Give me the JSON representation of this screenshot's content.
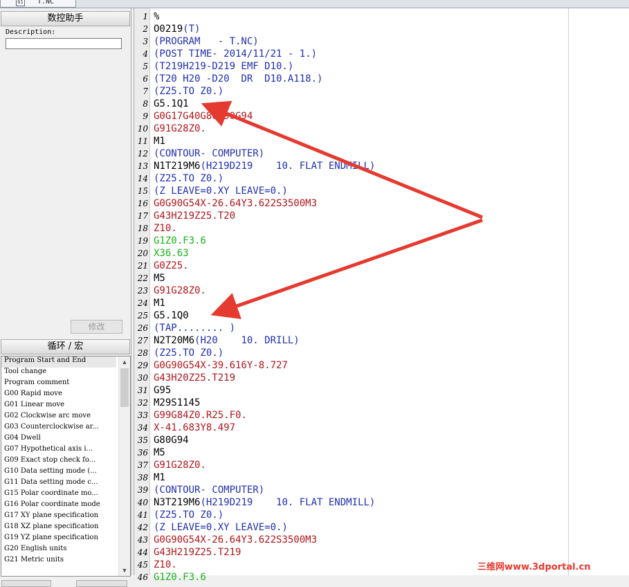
{
  "tab": {
    "icon": "file-icon",
    "icon_label": "G1",
    "label": "T.NC"
  },
  "left_panel": {
    "title": "数控助手",
    "description_label": "Description:",
    "description_value": "",
    "modify_button": "修改",
    "macros_title": "循环 / 宏",
    "macros": [
      "Program Start and End",
      "Tool change",
      "Program comment",
      "G00 Rapid move",
      "G01 Linear move",
      "G02 Clockwise arc move",
      "G03 Counterclockwise ar...",
      "G04 Dwell",
      "G07 Hypothetical axis i...",
      "G09 Exact stop check fo...",
      "G10 Data setting mode (...",
      "G11 Data setting mode c...",
      "G15 Polar coordinate mo...",
      "G16 Polar coordinate mode",
      "G17 XY plane specification",
      "G18 XZ plane specification",
      "G19 YZ plane specification",
      "G20 English units",
      "G21 Metric units"
    ]
  },
  "editor": {
    "lines": [
      {
        "n": "1",
        "t": "%",
        "c": "black"
      },
      {
        "n": "2",
        "t": "O0219(T)",
        "c": "black",
        "split": "O0219",
        "rest": "(T)",
        "rest_c": "blue"
      },
      {
        "n": "3",
        "t": "(PROGRAM   - T.NC)",
        "c": "blue"
      },
      {
        "n": "4",
        "t": "(POST TIME- 2014/11/21 - 1.)",
        "c": "blue"
      },
      {
        "n": "5",
        "t": "(T219H219-D219 EMF D10.)",
        "c": "blue"
      },
      {
        "n": "6",
        "t": "(T20 H20 -D20  DR  D10.A118.)",
        "c": "blue"
      },
      {
        "n": "7",
        "t": "(Z25.TO Z0.)",
        "c": "blue"
      },
      {
        "n": "8",
        "t": "G5.1Q1",
        "c": "black"
      },
      {
        "n": "9",
        "t": "G0G17G40G80G90G94",
        "c": "red"
      },
      {
        "n": "10",
        "t": "G91G28Z0.",
        "c": "red"
      },
      {
        "n": "11",
        "t": "M1",
        "c": "black"
      },
      {
        "n": "12",
        "t": "(CONTOUR- COMPUTER)",
        "c": "blue"
      },
      {
        "n": "13",
        "t": "N1T219M6(H219D219    10. FLAT ENDMILL)",
        "c": "black",
        "split": "N1T219M6",
        "rest": "(H219D219    10. FLAT ENDMILL)",
        "rest_c": "blue"
      },
      {
        "n": "14",
        "t": "(Z25.TO Z0.)",
        "c": "blue"
      },
      {
        "n": "15",
        "t": "(Z LEAVE=0.XY LEAVE=0.)",
        "c": "blue"
      },
      {
        "n": "16",
        "t": "G0G90G54X-26.64Y3.622S3500M3",
        "c": "red"
      },
      {
        "n": "17",
        "t": "G43H219Z25.T20",
        "c": "red"
      },
      {
        "n": "18",
        "t": "Z10.",
        "c": "red"
      },
      {
        "n": "19",
        "t": "G1Z0.F3.6",
        "c": "green"
      },
      {
        "n": "20",
        "t": "X36.63",
        "c": "green"
      },
      {
        "n": "21",
        "t": "G0Z25.",
        "c": "red"
      },
      {
        "n": "22",
        "t": "M5",
        "c": "black"
      },
      {
        "n": "23",
        "t": "G91G28Z0.",
        "c": "red"
      },
      {
        "n": "24",
        "t": "M1",
        "c": "black"
      },
      {
        "n": "25",
        "t": "G5.1Q0",
        "c": "black"
      },
      {
        "n": "26",
        "t": "(TAP........ )",
        "c": "blue"
      },
      {
        "n": "27",
        "t": "N2T20M6(H20    10. DRILL)",
        "c": "black",
        "split": "N2T20M6",
        "rest": "(H20    10. DRILL)",
        "rest_c": "blue"
      },
      {
        "n": "28",
        "t": "(Z25.TO Z0.)",
        "c": "blue"
      },
      {
        "n": "29",
        "t": "G0G90G54X-39.616Y-8.727",
        "c": "red"
      },
      {
        "n": "30",
        "t": "G43H20Z25.T219",
        "c": "red"
      },
      {
        "n": "31",
        "t": "G95",
        "c": "black"
      },
      {
        "n": "32",
        "t": "M29S1145",
        "c": "black"
      },
      {
        "n": "33",
        "t": "G99G84Z0.R25.F0.",
        "c": "red"
      },
      {
        "n": "34",
        "t": "X-41.683Y8.497",
        "c": "red"
      },
      {
        "n": "35",
        "t": "G80G94",
        "c": "black"
      },
      {
        "n": "36",
        "t": "M5",
        "c": "black"
      },
      {
        "n": "37",
        "t": "G91G28Z0.",
        "c": "red"
      },
      {
        "n": "38",
        "t": "M1",
        "c": "black"
      },
      {
        "n": "39",
        "t": "(CONTOUR- COMPUTER)",
        "c": "blue"
      },
      {
        "n": "40",
        "t": "N3T219M6(H219D219    10. FLAT ENDMILL)",
        "c": "black",
        "split": "N3T219M6",
        "rest": "(H219D219    10. FLAT ENDMILL)",
        "rest_c": "blue"
      },
      {
        "n": "41",
        "t": "(Z25.TO Z0.)",
        "c": "blue"
      },
      {
        "n": "42",
        "t": "(Z LEAVE=0.XY LEAVE=0.)",
        "c": "blue"
      },
      {
        "n": "43",
        "t": "G0G90G54X-26.64Y3.622S3500M3",
        "c": "red"
      },
      {
        "n": "44",
        "t": "G43H219Z25.T219",
        "c": "red"
      },
      {
        "n": "45",
        "t": "Z10.",
        "c": "red"
      },
      {
        "n": "46",
        "t": "G1Z0.F3.6",
        "c": "green"
      }
    ]
  },
  "watermark": "三维网www.3dportal.cn",
  "colors": {
    "comment": "#1f2eb0",
    "motion": "#b0161b",
    "feed": "#17b317",
    "annotation_arrow": "#e53a2f"
  }
}
